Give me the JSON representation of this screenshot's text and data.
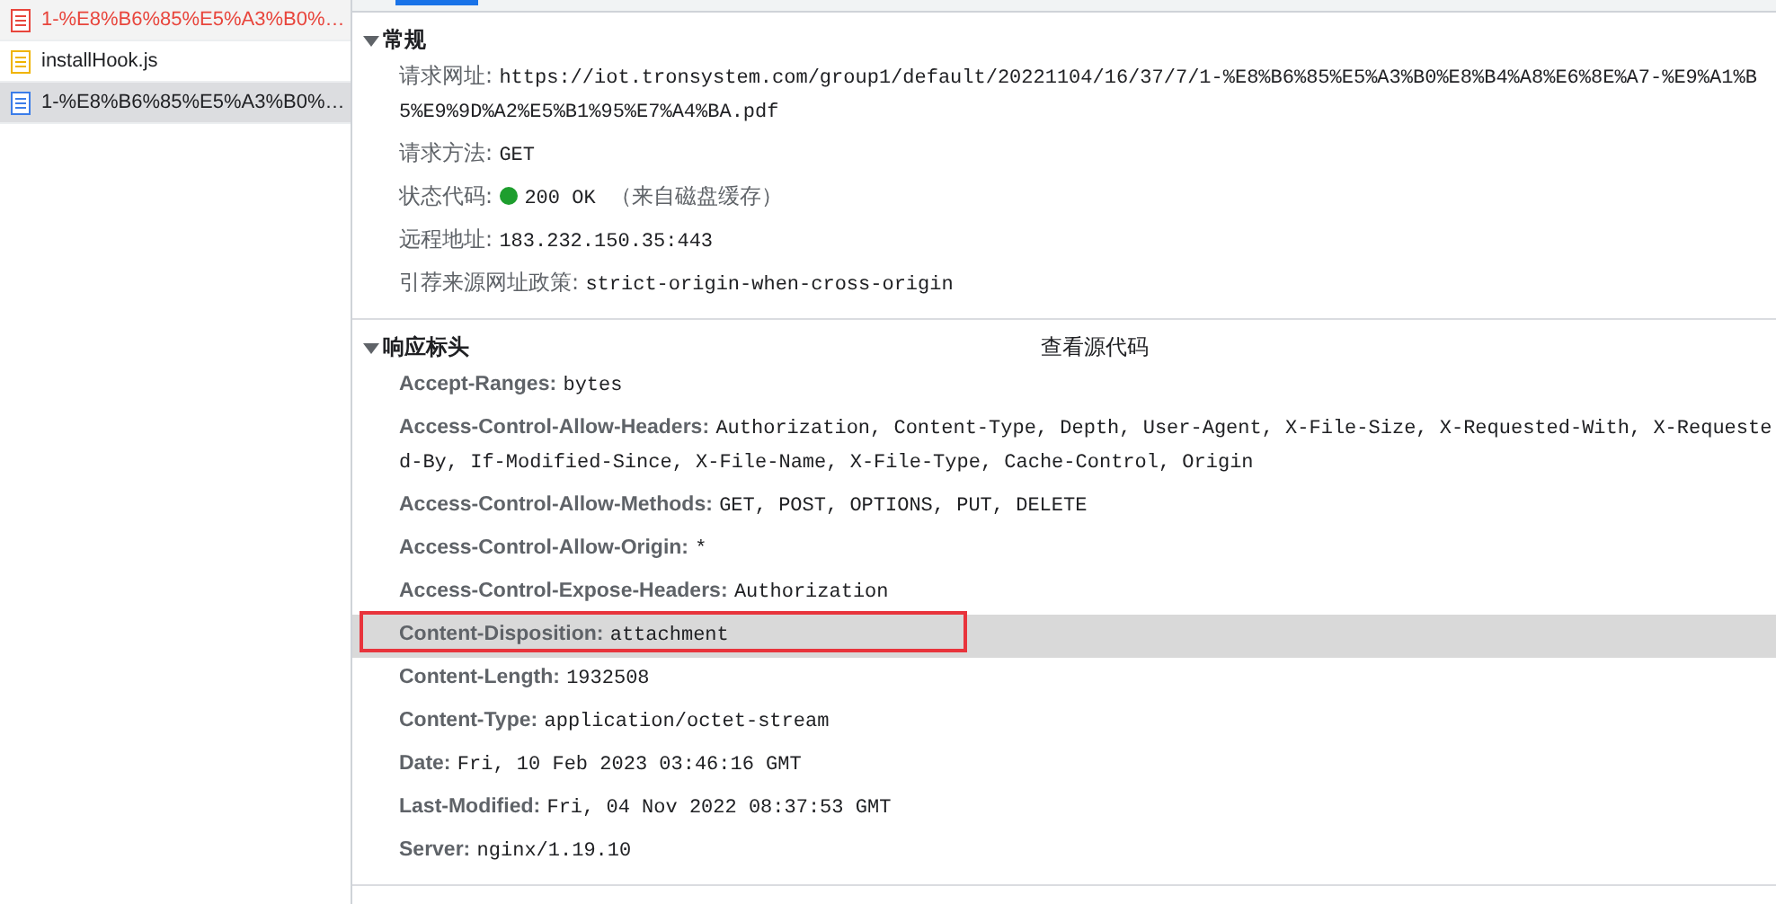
{
  "files": [
    {
      "name": "1-%E8%B6%85%E5%A3%B0%…",
      "color": "#e8453c",
      "failed": true,
      "selected": false
    },
    {
      "name": "installHook.js",
      "color": "#f0b400",
      "failed": false,
      "selected": false
    },
    {
      "name": "1-%E8%B6%85%E5%A3%B0%…",
      "color": "#3b7de9",
      "failed": false,
      "selected": true
    }
  ],
  "tabs": [
    {
      "selected": true
    }
  ],
  "general": {
    "title": "常规",
    "expanded": true,
    "rows": [
      {
        "kind": "text",
        "label": "请求网址:",
        "value": "https://iot.tronsystem.com/group1/default/20221104/16/37/7/1-%E8%B6%85%E5%A3%B0%E8%B4%A8%E6%8E%A7-%E9%A1%B5%E9%9D%A2%E5%B1%95%E7%A4%BA.pdf"
      },
      {
        "kind": "text",
        "label": "请求方法:",
        "value": "GET"
      },
      {
        "kind": "status",
        "label": "状态代码:",
        "value": "200 OK",
        "note": "（来自磁盘缓存）"
      },
      {
        "kind": "text",
        "label": "远程地址:",
        "value": "183.232.150.35:443"
      },
      {
        "kind": "text",
        "label": "引荐来源网址政策:",
        "value": "strict-origin-when-cross-origin"
      }
    ]
  },
  "response_headers": {
    "title": "响应标头",
    "expanded": true,
    "view_source": "查看源代码",
    "rows": [
      {
        "name": "Accept-Ranges:",
        "value": "bytes",
        "highlighted": false,
        "boxed": false
      },
      {
        "name": "Access-Control-Allow-Headers:",
        "value": "Authorization, Content-Type, Depth, User-Agent, X-File-Size, X-Requested-With, X-Requested-By, If-Modified-Since, X-File-Name, X-File-Type, Cache-Control, Origin",
        "highlighted": false,
        "boxed": false
      },
      {
        "name": "Access-Control-Allow-Methods:",
        "value": "GET, POST, OPTIONS, PUT, DELETE",
        "highlighted": false,
        "boxed": false
      },
      {
        "name": "Access-Control-Allow-Origin:",
        "value": "*",
        "highlighted": false,
        "boxed": false
      },
      {
        "name": "Access-Control-Expose-Headers:",
        "value": "Authorization",
        "highlighted": false,
        "boxed": false
      },
      {
        "name": "Content-Disposition:",
        "value": "attachment",
        "highlighted": true,
        "boxed": true
      },
      {
        "name": "Content-Length:",
        "value": "1932508",
        "highlighted": false,
        "boxed": false
      },
      {
        "name": "Content-Type:",
        "value": "application/octet-stream",
        "highlighted": false,
        "boxed": false
      },
      {
        "name": "Date:",
        "value": "Fri, 10 Feb 2023 03:46:16 GMT",
        "highlighted": false,
        "boxed": false
      },
      {
        "name": "Last-Modified:",
        "value": "Fri, 04 Nov 2022 08:37:53 GMT",
        "highlighted": false,
        "boxed": false
      },
      {
        "name": "Server:",
        "value": "nginx/1.19.10",
        "highlighted": false,
        "boxed": false
      }
    ]
  }
}
